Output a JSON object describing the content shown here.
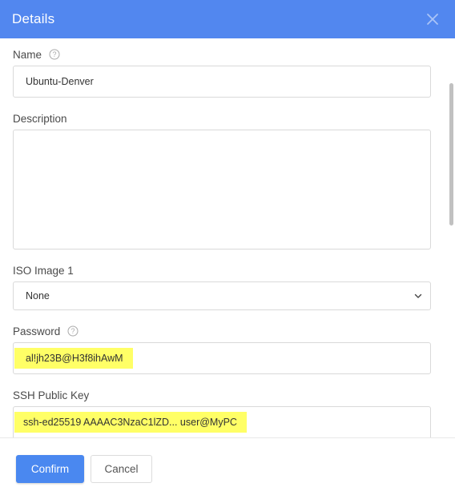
{
  "header": {
    "title": "Details",
    "close_icon": "close-icon"
  },
  "form": {
    "name": {
      "label": "Name",
      "value": "Ubuntu-Denver",
      "help_icon": "question-circle-icon"
    },
    "description": {
      "label": "Description",
      "value": ""
    },
    "iso_image": {
      "label": "ISO Image 1",
      "selected": "None",
      "icon": "chevron-down-icon"
    },
    "password": {
      "label": "Password",
      "value": "al!jh23B@H3f8ihAwM",
      "help_icon": "question-circle-icon"
    },
    "ssh_key": {
      "label": "SSH Public Key",
      "value": "ssh-ed25519 AAAAC3NzaC1lZD... user@MyPC"
    }
  },
  "footer": {
    "confirm_label": "Confirm",
    "cancel_label": "Cancel"
  },
  "colors": {
    "header_bg": "#5287ef",
    "primary_button": "#4a88f0",
    "highlight": "#ffff66"
  }
}
